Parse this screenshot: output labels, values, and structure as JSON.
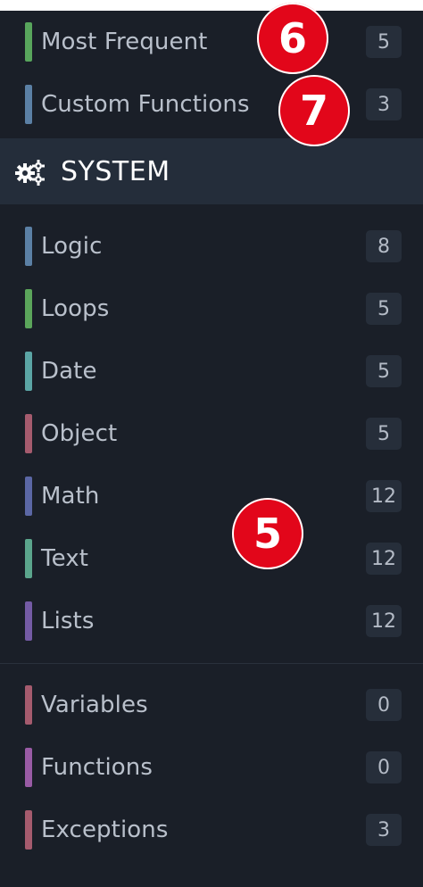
{
  "top_items": [
    {
      "label": "Most Frequent",
      "count": "5",
      "color": "#58a55c"
    },
    {
      "label": "Custom Functions",
      "count": "3",
      "color": "#5b80a5"
    }
  ],
  "system": {
    "title": "SYSTEM",
    "icon": "gears-icon"
  },
  "system_items": [
    {
      "label": "Logic",
      "count": "8",
      "color": "#5b80a5"
    },
    {
      "label": "Loops",
      "count": "5",
      "color": "#5ba55b"
    },
    {
      "label": "Date",
      "count": "5",
      "color": "#5ba5a5"
    },
    {
      "label": "Object",
      "count": "5",
      "color": "#a55b6e"
    },
    {
      "label": "Math",
      "count": "12",
      "color": "#5b67a5"
    },
    {
      "label": "Text",
      "count": "12",
      "color": "#5ba58c"
    },
    {
      "label": "Lists",
      "count": "12",
      "color": "#745ba5"
    }
  ],
  "bottom_items": [
    {
      "label": "Variables",
      "count": "0",
      "color": "#a55b6e"
    },
    {
      "label": "Functions",
      "count": "0",
      "color": "#995ba5"
    },
    {
      "label": "Exceptions",
      "count": "3",
      "color": "#a55b6e"
    }
  ],
  "annotations": [
    "6",
    "7",
    "5"
  ]
}
